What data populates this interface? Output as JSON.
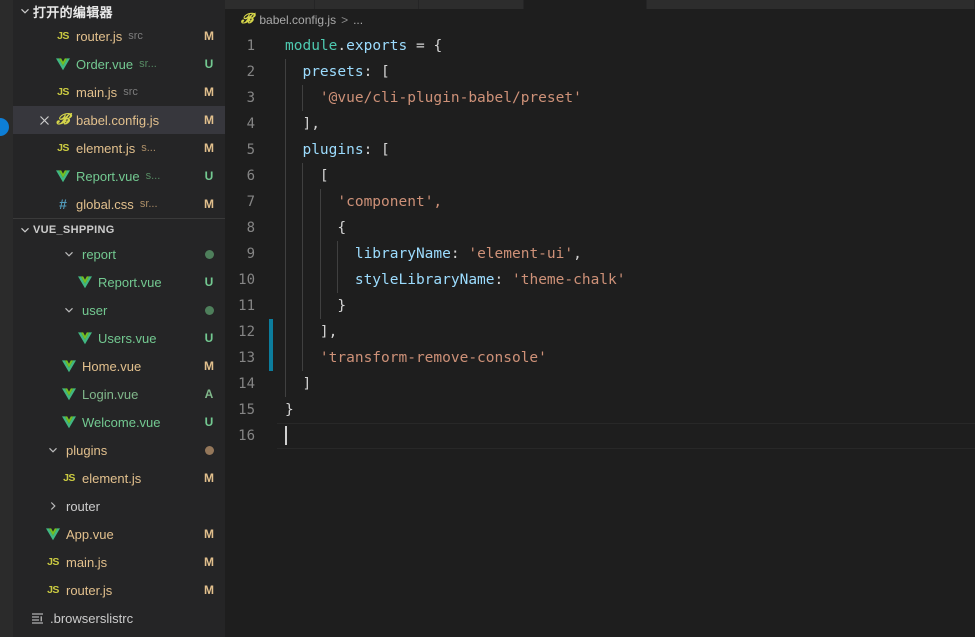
{
  "colors": {
    "sidebar_bg": "#252526",
    "editor_bg": "#1e1e1e",
    "selection": "#37373d",
    "modified": "#e2c08d",
    "untracked": "#73c991",
    "added": "#81b88b",
    "badge_blue": "#0d7ed6",
    "dirty_gutter": "#0c7d9d",
    "string": "#ce9178",
    "property": "#9cdcfe",
    "object": "#4ec9b0"
  },
  "sidebar": {
    "open_editors": {
      "title": "打开的编辑器",
      "twisty": "chevron-down-icon",
      "items": [
        {
          "icon": "js-file-icon",
          "name": "router.js",
          "desc": "src",
          "badge": "M",
          "name_class": "mod",
          "desc_class": "norm",
          "selected": false,
          "has_close": false
        },
        {
          "icon": "vue-file-icon",
          "name": "Order.vue",
          "desc": "sr...",
          "badge": "U",
          "name_class": "unt",
          "desc_class": "unt",
          "selected": false,
          "has_close": false
        },
        {
          "icon": "js-file-icon",
          "name": "main.js",
          "desc": "src",
          "badge": "M",
          "name_class": "mod",
          "desc_class": "norm",
          "selected": false,
          "has_close": false
        },
        {
          "icon": "babel-file-icon",
          "name": "babel.config.js",
          "desc": "",
          "badge": "M",
          "name_class": "mod",
          "desc_class": "norm",
          "selected": true,
          "has_close": true
        },
        {
          "icon": "js-file-icon",
          "name": "element.js",
          "desc": "s...",
          "badge": "M",
          "name_class": "mod",
          "desc_class": "mod",
          "selected": false,
          "has_close": false
        },
        {
          "icon": "vue-file-icon",
          "name": "Report.vue",
          "desc": "s...",
          "badge": "U",
          "name_class": "unt",
          "desc_class": "unt",
          "selected": false,
          "has_close": false
        },
        {
          "icon": "css-file-icon",
          "name": "global.css",
          "desc": "sr...",
          "badge": "M",
          "name_class": "mod",
          "desc_class": "mod",
          "selected": false,
          "has_close": false
        }
      ]
    },
    "explorer": {
      "title": "VUE_SHPPING",
      "twisty": "chevron-down-icon",
      "items": [
        {
          "type": "folder",
          "icon": "chevron-down-icon",
          "name": "report",
          "indent": 2,
          "name_class": "unt",
          "dot": "green",
          "badge": ""
        },
        {
          "type": "file",
          "icon": "vue-file-icon",
          "name": "Report.vue",
          "indent": 3,
          "name_class": "unt",
          "dot": "",
          "badge": "U"
        },
        {
          "type": "folder",
          "icon": "chevron-down-icon",
          "name": "user",
          "indent": 2,
          "name_class": "unt",
          "dot": "green",
          "badge": ""
        },
        {
          "type": "file",
          "icon": "vue-file-icon",
          "name": "Users.vue",
          "indent": 3,
          "name_class": "unt",
          "dot": "",
          "badge": "U"
        },
        {
          "type": "file",
          "icon": "vue-file-icon",
          "name": "Home.vue",
          "indent": 2,
          "name_class": "mod",
          "dot": "",
          "badge": "M"
        },
        {
          "type": "file",
          "icon": "vue-file-icon",
          "name": "Login.vue",
          "indent": 2,
          "name_class": "add",
          "dot": "",
          "badge": "A"
        },
        {
          "type": "file",
          "icon": "vue-file-icon",
          "name": "Welcome.vue",
          "indent": 2,
          "name_class": "unt",
          "dot": "",
          "badge": "U"
        },
        {
          "type": "folder",
          "icon": "chevron-down-icon",
          "name": "plugins",
          "indent": 1,
          "name_class": "mod",
          "dot": "tan",
          "badge": ""
        },
        {
          "type": "file",
          "icon": "js-file-icon",
          "name": "element.js",
          "indent": 2,
          "name_class": "mod",
          "dot": "",
          "badge": "M"
        },
        {
          "type": "folder",
          "icon": "chevron-right-icon",
          "name": "router",
          "indent": 1,
          "name_class": "norm",
          "dot": "",
          "badge": ""
        },
        {
          "type": "file",
          "icon": "vue-file-icon",
          "name": "App.vue",
          "indent": 1,
          "name_class": "mod",
          "dot": "",
          "badge": "M"
        },
        {
          "type": "file",
          "icon": "js-file-icon",
          "name": "main.js",
          "indent": 1,
          "name_class": "mod",
          "dot": "",
          "badge": "M"
        },
        {
          "type": "file",
          "icon": "js-file-icon",
          "name": "router.js",
          "indent": 1,
          "name_class": "mod",
          "dot": "",
          "badge": "M"
        },
        {
          "type": "file",
          "icon": "config-file-icon",
          "name": ".browserslistrc",
          "indent": 0,
          "name_class": "norm",
          "dot": "",
          "badge": ""
        }
      ]
    }
  },
  "editor": {
    "breadcrumb": {
      "file_icon": "babel-file-icon",
      "file": "babel.config.js",
      "separator": ">",
      "trail": "..."
    },
    "line_numbers": [
      "1",
      "2",
      "3",
      "4",
      "5",
      "6",
      "7",
      "8",
      "9",
      "10",
      "11",
      "12",
      "13",
      "14",
      "15",
      "16"
    ],
    "dirty_lines": [
      12,
      13
    ],
    "active_line": 16,
    "lines": [
      {
        "n": "1",
        "tokens": [
          {
            "t": "module",
            "c": "t-obj"
          },
          {
            "t": ".",
            "c": "t-punc"
          },
          {
            "t": "exports",
            "c": "t-prop"
          },
          {
            "t": " = ",
            "c": "t-op"
          },
          {
            "t": "{",
            "c": "t-brk"
          }
        ],
        "indent": 0
      },
      {
        "n": "2",
        "tokens": [
          {
            "t": "  ",
            "c": "t-punc"
          },
          {
            "t": "presets",
            "c": "t-prop"
          },
          {
            "t": ": ",
            "c": "t-punc"
          },
          {
            "t": "[",
            "c": "t-brk"
          }
        ],
        "indent": 1
      },
      {
        "n": "3",
        "tokens": [
          {
            "t": "    ",
            "c": "t-punc"
          },
          {
            "t": "'@vue/cli-plugin-babel/preset'",
            "c": "t-str"
          }
        ],
        "indent": 2
      },
      {
        "n": "4",
        "tokens": [
          {
            "t": "  ",
            "c": "t-punc"
          },
          {
            "t": "],",
            "c": "t-brk"
          }
        ],
        "indent": 1
      },
      {
        "n": "5",
        "tokens": [
          {
            "t": "  ",
            "c": "t-punc"
          },
          {
            "t": "plugins",
            "c": "t-prop"
          },
          {
            "t": ": ",
            "c": "t-punc"
          },
          {
            "t": "[",
            "c": "t-brk"
          }
        ],
        "indent": 1
      },
      {
        "n": "6",
        "tokens": [
          {
            "t": "    ",
            "c": "t-punc"
          },
          {
            "t": "[",
            "c": "t-brk"
          }
        ],
        "indent": 2
      },
      {
        "n": "7",
        "tokens": [
          {
            "t": "      ",
            "c": "t-punc"
          },
          {
            "t": "'component',",
            "c": "t-str"
          }
        ],
        "indent": 3
      },
      {
        "n": "8",
        "tokens": [
          {
            "t": "      ",
            "c": "t-punc"
          },
          {
            "t": "{",
            "c": "t-brk"
          }
        ],
        "indent": 3
      },
      {
        "n": "9",
        "tokens": [
          {
            "t": "        ",
            "c": "t-punc"
          },
          {
            "t": "libraryName",
            "c": "t-prop"
          },
          {
            "t": ": ",
            "c": "t-punc"
          },
          {
            "t": "'element-ui'",
            "c": "t-str"
          },
          {
            "t": ",",
            "c": "t-punc"
          }
        ],
        "indent": 4
      },
      {
        "n": "10",
        "tokens": [
          {
            "t": "        ",
            "c": "t-punc"
          },
          {
            "t": "styleLibraryName",
            "c": "t-prop"
          },
          {
            "t": ": ",
            "c": "t-punc"
          },
          {
            "t": "'theme-chalk'",
            "c": "t-str"
          }
        ],
        "indent": 4
      },
      {
        "n": "11",
        "tokens": [
          {
            "t": "      ",
            "c": "t-punc"
          },
          {
            "t": "}",
            "c": "t-brk"
          }
        ],
        "indent": 3
      },
      {
        "n": "12",
        "tokens": [
          {
            "t": "    ",
            "c": "t-punc"
          },
          {
            "t": "],",
            "c": "t-brk"
          }
        ],
        "indent": 2
      },
      {
        "n": "13",
        "tokens": [
          {
            "t": "    ",
            "c": "t-punc"
          },
          {
            "t": "'transform-remove-console'",
            "c": "t-str"
          }
        ],
        "indent": 2
      },
      {
        "n": "14",
        "tokens": [
          {
            "t": "  ",
            "c": "t-punc"
          },
          {
            "t": "]",
            "c": "t-brk"
          }
        ],
        "indent": 1
      },
      {
        "n": "15",
        "tokens": [
          {
            "t": "}",
            "c": "t-brk"
          }
        ],
        "indent": 0
      },
      {
        "n": "16",
        "tokens": [],
        "indent": 0
      }
    ]
  }
}
